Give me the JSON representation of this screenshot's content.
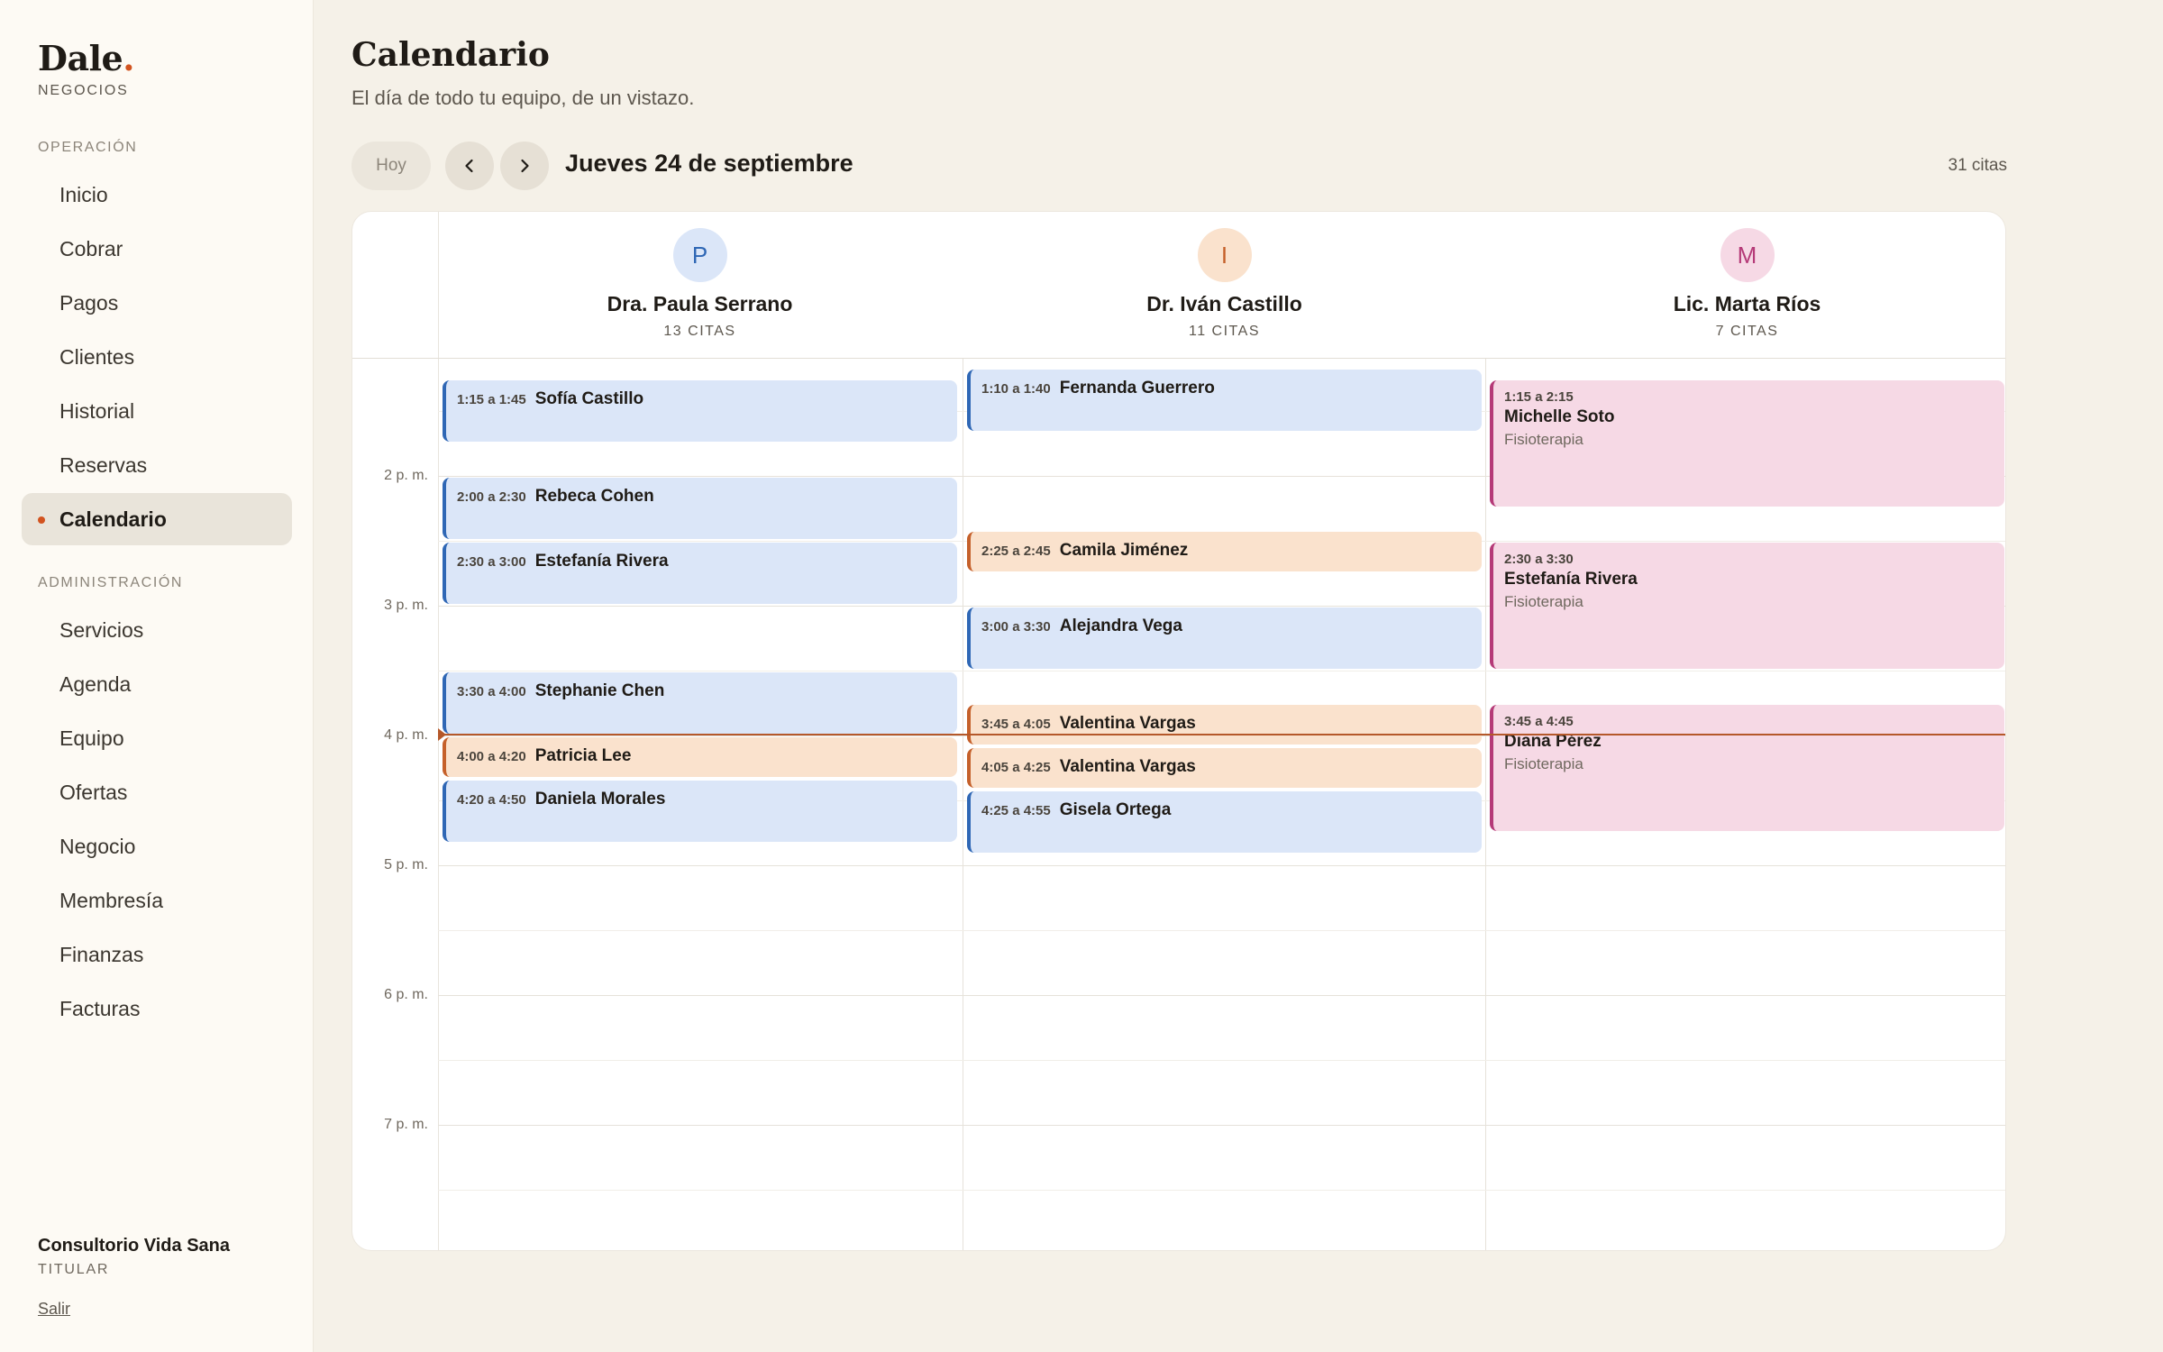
{
  "brand": {
    "name": "Dale",
    "dot": ".",
    "subtitle": "NEGOCIOS"
  },
  "sidebar": {
    "section_operation": "OPERACIÓN",
    "section_admin": "ADMINISTRACIÓN",
    "operation_items": [
      "Inicio",
      "Cobrar",
      "Pagos",
      "Clientes",
      "Historial",
      "Reservas",
      "Calendario"
    ],
    "admin_items": [
      "Servicios",
      "Agenda",
      "Equipo",
      "Ofertas",
      "Negocio",
      "Membresía",
      "Finanzas",
      "Facturas"
    ],
    "active_item": "Calendario",
    "org_name": "Consultorio Vida Sana",
    "org_role": "TITULAR",
    "logout": "Salir"
  },
  "header": {
    "title": "Calendario",
    "subtitle": "El día de todo tu equipo, de un vistazo.",
    "today_button": "Hoy",
    "prev_icon": "chevron-left-icon",
    "next_icon": "chevron-right-icon",
    "date": "Jueves 24 de septiembre",
    "total": "31 citas"
  },
  "time_labels": [
    "2 p. m.",
    "3 p. m.",
    "4 p. m.",
    "5 p. m.",
    "6 p. m.",
    "7 p. m."
  ],
  "colors": {
    "accent": "#d2531f",
    "blue": "#2f67b5",
    "orange": "#c5602a",
    "pink": "#b53a78"
  },
  "columns": [
    {
      "initial": "P",
      "name": "Dra. Paula Serrano",
      "count": "13 CITAS",
      "avatar_bg": "#dbe6f8",
      "avatar_fg": "#2f67b5",
      "appointments": [
        {
          "time": "1:15 a 1:45",
          "name": "Sofía Castillo",
          "color": "blue",
          "start": 13.25,
          "end": 13.75
        },
        {
          "time": "2:00 a 2:30",
          "name": "Rebeca Cohen",
          "color": "blue",
          "start": 14.0,
          "end": 14.5
        },
        {
          "time": "2:30 a 3:00",
          "name": "Estefanía Rivera",
          "color": "blue",
          "start": 14.5,
          "end": 15.0
        },
        {
          "time": "3:30 a 4:00",
          "name": "Stephanie Chen",
          "color": "blue",
          "start": 15.5,
          "end": 16.0
        },
        {
          "time": "4:00 a 4:20",
          "name": "Patricia Lee",
          "color": "orange",
          "start": 16.0,
          "end": 16.333
        },
        {
          "time": "4:20 a 4:50",
          "name": "Daniela Morales",
          "color": "blue",
          "start": 16.333,
          "end": 16.833
        }
      ]
    },
    {
      "initial": "I",
      "name": "Dr. Iván Castillo",
      "count": "11 CITAS",
      "avatar_bg": "#fae2cd",
      "avatar_fg": "#c5602a",
      "appointments": [
        {
          "time": "",
          "name": "",
          "color": "orange",
          "start": 12.9,
          "end": 13.05
        },
        {
          "time": "1:10 a 1:40",
          "name": "Fernanda Guerrero",
          "color": "blue",
          "start": 13.167,
          "end": 13.667
        },
        {
          "time": "2:25 a 2:45",
          "name": "Camila Jiménez",
          "color": "orange",
          "start": 14.417,
          "end": 14.75
        },
        {
          "time": "3:00 a 3:30",
          "name": "Alejandra Vega",
          "color": "blue",
          "start": 15.0,
          "end": 15.5
        },
        {
          "time": "3:45 a 4:05",
          "name": "Valentina Vargas",
          "color": "orange",
          "start": 15.75,
          "end": 16.083
        },
        {
          "time": "4:05 a 4:25",
          "name": "Valentina Vargas",
          "color": "orange",
          "start": 16.083,
          "end": 16.417
        },
        {
          "time": "4:25 a 4:55",
          "name": "Gisela Ortega",
          "color": "blue",
          "start": 16.417,
          "end": 16.917
        }
      ]
    },
    {
      "initial": "M",
      "name": "Lic. Marta Ríos",
      "count": "7 CITAS",
      "avatar_bg": "#f6d9e5",
      "avatar_fg": "#b53a78",
      "appointments": [
        {
          "time": "",
          "name": "",
          "service": "",
          "color": "pink",
          "start": 12.5,
          "end": 13.1
        },
        {
          "time": "1:15 a 2:15",
          "name": "Michelle Soto",
          "service": "Fisioterapia",
          "color": "pink",
          "start": 13.25,
          "end": 14.25
        },
        {
          "time": "2:30 a 3:30",
          "name": "Estefanía Rivera",
          "service": "Fisioterapia",
          "color": "pink",
          "start": 14.5,
          "end": 15.5
        },
        {
          "time": "3:45 a 4:45",
          "name": "Diana Pérez",
          "service": "Fisioterapia",
          "color": "pink",
          "start": 15.75,
          "end": 16.75
        }
      ]
    }
  ]
}
